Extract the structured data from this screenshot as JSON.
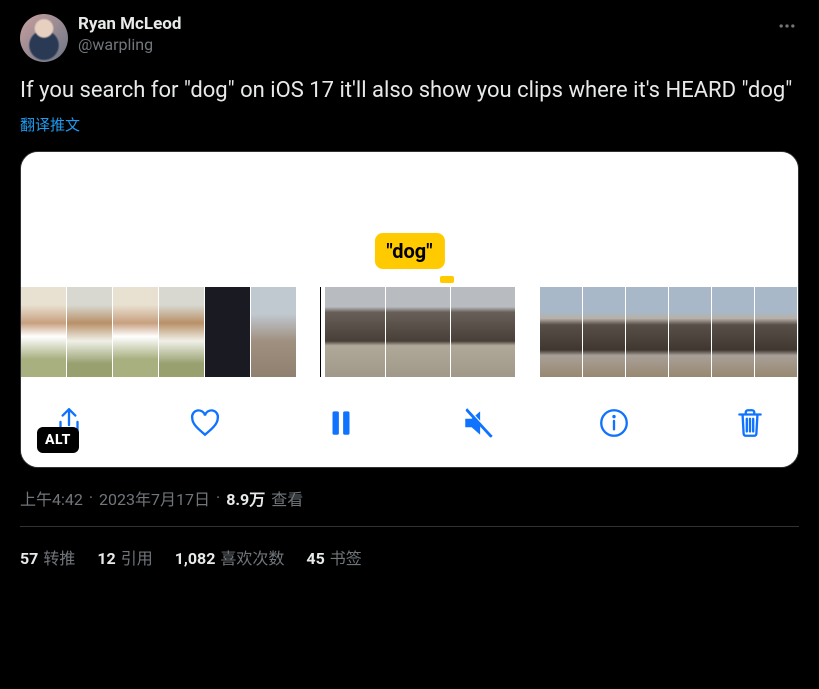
{
  "user": {
    "display_name": "Ryan McLeod",
    "handle": "@warpling"
  },
  "tweet_text": "If you search for \"dog\" on iOS 17 it'll also show you clips where it's HEARD \"dog\"",
  "translate_label": "翻译推文",
  "media": {
    "search_chip": "\"dog\"",
    "alt_badge": "ALT"
  },
  "meta": {
    "time": "上午4:42",
    "date": "2023年7月17日",
    "separator": "·",
    "views_count": "8.9万",
    "views_label": "查看"
  },
  "stats": {
    "retweets": {
      "count": "57",
      "label": "转推"
    },
    "quotes": {
      "count": "12",
      "label": "引用"
    },
    "likes": {
      "count": "1,082",
      "label": "喜欢次数"
    },
    "bookmarks": {
      "count": "45",
      "label": "书签"
    }
  }
}
